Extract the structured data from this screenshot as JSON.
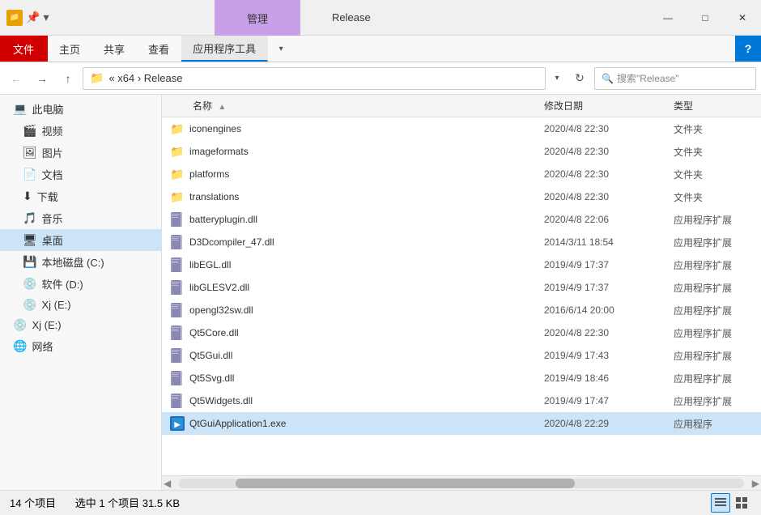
{
  "titleBar": {
    "tabLabel": "管理",
    "windowTitle": "Release",
    "minimize": "—",
    "maximize": "□",
    "close": "✕"
  },
  "ribbon": {
    "tabs": [
      "文件",
      "主页",
      "共享",
      "查看",
      "应用程序工具"
    ],
    "helpLabel": "?",
    "activeTab": "应用程序工具"
  },
  "addressBar": {
    "breadcrumb": "« x64 › Release",
    "searchPlaceholder": "搜索\"Release\""
  },
  "sidebar": {
    "items": [
      {
        "icon": "💻",
        "label": "此电脑",
        "expandable": false
      },
      {
        "icon": "🎬",
        "label": "视频",
        "expandable": false
      },
      {
        "icon": "🖼",
        "label": "图片",
        "expandable": false
      },
      {
        "icon": "📄",
        "label": "文档",
        "expandable": false
      },
      {
        "icon": "⬇",
        "label": "下载",
        "expandable": false
      },
      {
        "icon": "🎵",
        "label": "音乐",
        "expandable": false
      },
      {
        "icon": "🖥",
        "label": "桌面",
        "expandable": false,
        "active": true
      },
      {
        "icon": "💾",
        "label": "本地磁盘 (C:)",
        "expandable": false
      },
      {
        "icon": "💿",
        "label": "软件 (D:)",
        "expandable": false
      },
      {
        "icon": "💿",
        "label": "Xj (E:)",
        "expandable": false
      },
      {
        "icon": "💿",
        "label": "Xj (E:)",
        "expandable": false
      },
      {
        "icon": "🌐",
        "label": "网络",
        "expandable": false
      }
    ]
  },
  "fileList": {
    "columns": {
      "name": "名称",
      "date": "修改日期",
      "type": "类型"
    },
    "files": [
      {
        "icon": "folder",
        "name": "iconengines",
        "date": "2020/4/8 22:30",
        "type": "文件夹"
      },
      {
        "icon": "folder",
        "name": "imageformats",
        "date": "2020/4/8 22:30",
        "type": "文件夹"
      },
      {
        "icon": "folder",
        "name": "platforms",
        "date": "2020/4/8 22:30",
        "type": "文件夹"
      },
      {
        "icon": "folder",
        "name": "translations",
        "date": "2020/4/8 22:30",
        "type": "文件夹"
      },
      {
        "icon": "dll",
        "name": "batteryplugin.dll",
        "date": "2020/4/8 22:06",
        "type": "应用程序扩展"
      },
      {
        "icon": "dll",
        "name": "D3Dcompiler_47.dll",
        "date": "2014/3/11 18:54",
        "type": "应用程序扩展"
      },
      {
        "icon": "dll",
        "name": "libEGL.dll",
        "date": "2019/4/9 17:37",
        "type": "应用程序扩展"
      },
      {
        "icon": "dll",
        "name": "libGLESV2.dll",
        "date": "2019/4/9 17:37",
        "type": "应用程序扩展"
      },
      {
        "icon": "dll",
        "name": "opengl32sw.dll",
        "date": "2016/6/14 20:00",
        "type": "应用程序扩展"
      },
      {
        "icon": "dll",
        "name": "Qt5Core.dll",
        "date": "2020/4/8 22:30",
        "type": "应用程序扩展"
      },
      {
        "icon": "dll",
        "name": "Qt5Gui.dll",
        "date": "2019/4/9 17:43",
        "type": "应用程序扩展"
      },
      {
        "icon": "dll",
        "name": "Qt5Svg.dll",
        "date": "2019/4/9 18:46",
        "type": "应用程序扩展"
      },
      {
        "icon": "dll",
        "name": "Qt5Widgets.dll",
        "date": "2019/4/9 17:47",
        "type": "应用程序扩展"
      },
      {
        "icon": "exe",
        "name": "QtGuiApplication1.exe",
        "date": "2020/4/8 22:29",
        "type": "应用程序",
        "selected": true
      }
    ]
  },
  "statusBar": {
    "itemCount": "14 个项目",
    "selected": "选中 1 个项目  31.5 KB"
  }
}
